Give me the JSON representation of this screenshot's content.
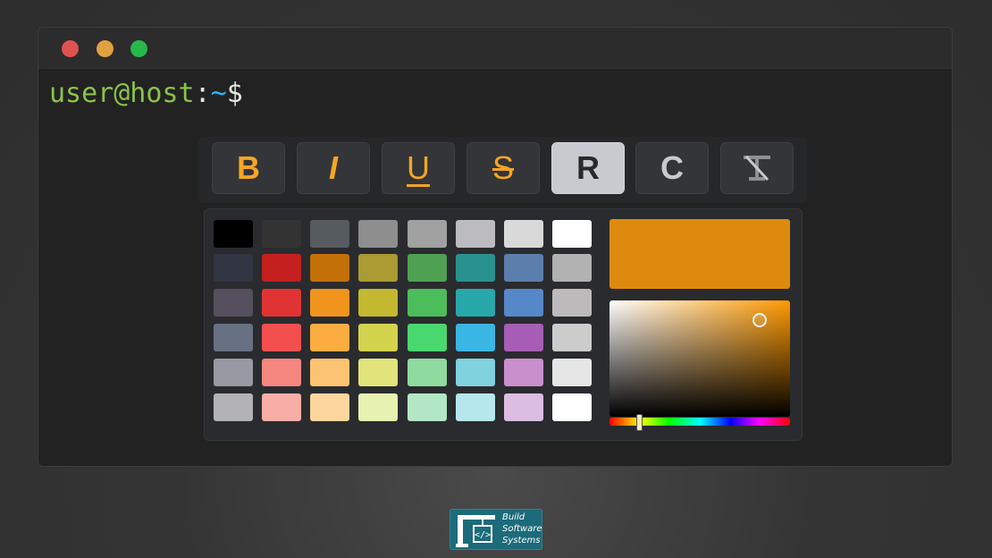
{
  "terminal": {
    "user_host": "user@host",
    "separator": ":",
    "path": "~",
    "prompt_symbol": "$",
    "colors": {
      "user_host": "#8bc34a",
      "separator": "#e6e6e6",
      "path": "#29b6f6",
      "prompt_symbol": "#e6e6e6"
    }
  },
  "window_controls": {
    "close": {
      "color": "#e05252"
    },
    "minimize": {
      "color": "#e0a040"
    },
    "maximize": {
      "color": "#28b84a"
    }
  },
  "toolbar": {
    "buttons": [
      {
        "name": "bold-button",
        "label": "B",
        "state": "normal"
      },
      {
        "name": "italic-button",
        "label": "I",
        "state": "normal"
      },
      {
        "name": "underline-button",
        "label": "U",
        "state": "normal"
      },
      {
        "name": "strikethrough-button",
        "label": "S",
        "state": "normal"
      },
      {
        "name": "reverse-button",
        "label": "R",
        "state": "active"
      },
      {
        "name": "color-button",
        "label": "C",
        "state": "normal"
      },
      {
        "name": "clear-format-button",
        "icon": "clear-format-icon",
        "state": "normal"
      }
    ]
  },
  "color_picker": {
    "selected_color": "#dd8a0e",
    "saturation_value": {
      "saturation": 0.8,
      "value": 0.9
    },
    "hue_degrees": 36,
    "swatches": [
      [
        "#000000",
        "#333333",
        "#555b5e",
        "#8e8e8e",
        "#a1a1a1",
        "#bcbbc0",
        "#d9d9d9",
        "#ffffff"
      ],
      [
        "#323542",
        "#c3201f",
        "#c37008",
        "#aa9c32",
        "#4fa152",
        "#29928f",
        "#5b7ead",
        "#b2b2b2"
      ],
      [
        "#564f5d",
        "#e03434",
        "#f0941e",
        "#c4b830",
        "#4cbd5b",
        "#28a8aa",
        "#5687c8",
        "#bcbaba"
      ],
      [
        "#677181",
        "#f44f4f",
        "#fbad42",
        "#d4d34e",
        "#4ad870",
        "#3ab6e4",
        "#a75cb6",
        "#cccccc"
      ],
      [
        "#979aa3",
        "#f48680",
        "#fcc472",
        "#e1e47a",
        "#8fda9f",
        "#80d2df",
        "#c98fcd",
        "#e6e6e6"
      ],
      [
        "#b3b3b6",
        "#f6aea6",
        "#fcd69d",
        "#e7f1b2",
        "#b3e6c4",
        "#b5e7ed",
        "#dbbde2",
        "#ffffff"
      ]
    ]
  },
  "logo": {
    "lines": [
      "Build",
      "Software",
      "Systems"
    ],
    "background": "#1c6b7a"
  }
}
